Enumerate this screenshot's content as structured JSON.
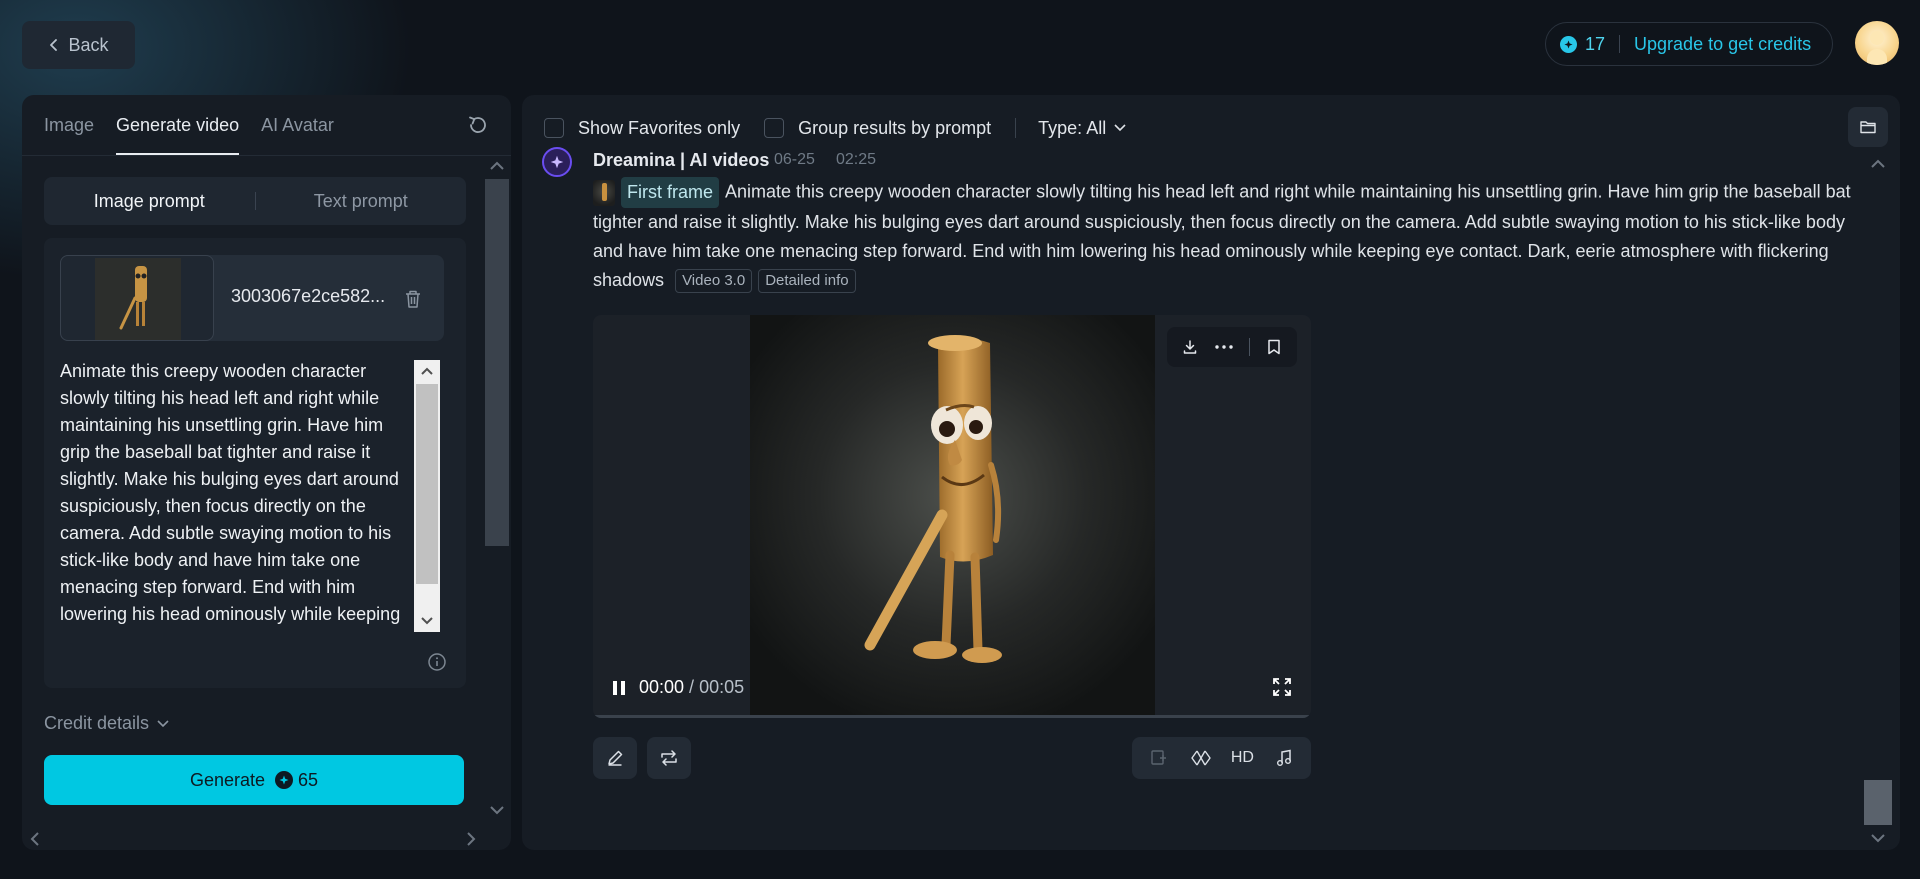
{
  "header": {
    "back_label": "Back",
    "credits_count": "17",
    "upgrade_label": "Upgrade to get credits"
  },
  "left_panel": {
    "tabs": [
      {
        "label": "Image",
        "active": false
      },
      {
        "label": "Generate video",
        "active": true
      },
      {
        "label": "AI Avatar",
        "active": false
      }
    ],
    "prompt_modes": {
      "image_prompt": "Image prompt",
      "text_prompt": "Text prompt"
    },
    "file_name": "3003067e2ce582...",
    "prompt_text": "Animate this creepy wooden character slowly tilting his head left and right while maintaining his unsettling grin. Have him grip the baseball bat tighter and raise it slightly. Make his bulging eyes dart around suspiciously, then focus directly on the camera. Add subtle swaying motion to his stick-like body and have him take one menacing step forward. End with him lowering his head ominously while keeping",
    "credit_details_label": "Credit details",
    "generate_label": "Generate",
    "generate_cost": "65"
  },
  "right_panel": {
    "filters": {
      "favorites_label": "Show Favorites only",
      "group_label": "Group results by prompt",
      "type_label": "Type: All"
    },
    "record": {
      "title": "Dreamina | AI videos",
      "date": "06-25",
      "time": "02:25",
      "frame_label": "First frame",
      "description": "Animate this creepy wooden character slowly tilting his head left and right while maintaining his unsettling grin. Have him grip the baseball bat tighter and raise it slightly. Make his bulging eyes dart around suspiciously, then focus directly on the camera. Add subtle swaying motion to his stick-like body and have him take one menacing step forward. End with him lowering his head ominously while keeping eye contact. Dark, eerie atmosphere with flickering shadows",
      "model_tag": "Video 3.0",
      "details_tag": "Detailed info"
    },
    "video": {
      "current_time": "00:00",
      "separator": " / ",
      "total_time": "00:05",
      "progress": 0
    },
    "actions": {
      "hd_label": "HD"
    }
  },
  "colors": {
    "accent": "#00c8e2",
    "background": "#0f141b",
    "panel": "#161c24"
  },
  "icons": [
    "chevron-left-icon",
    "coin-icon",
    "reset-icon",
    "trash-icon",
    "info-icon",
    "chevron-down-icon",
    "folder-icon",
    "dreamina-logo-icon",
    "download-icon",
    "more-icon",
    "bookmark-icon",
    "pause-icon",
    "fullscreen-icon",
    "edit-icon",
    "regenerate-icon",
    "frame-extend-icon",
    "lipsync-icon",
    "music-icon"
  ]
}
